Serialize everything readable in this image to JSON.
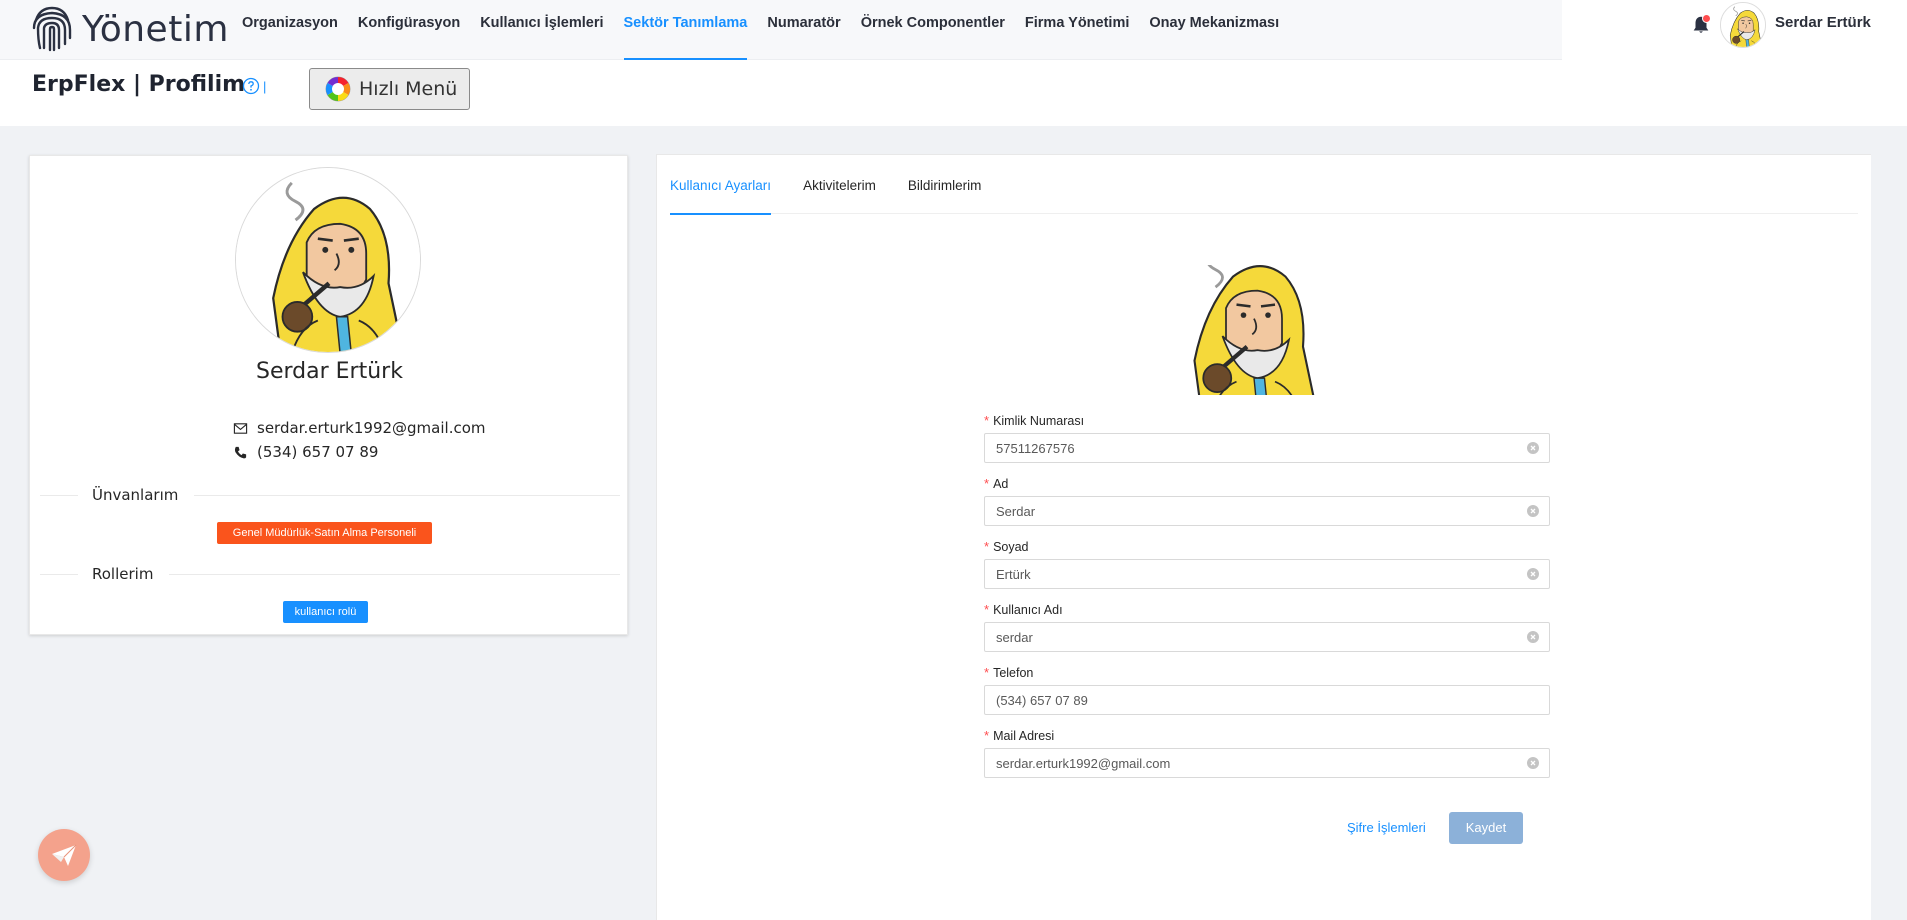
{
  "brand": {
    "name": "Yönetim"
  },
  "nav": {
    "items": [
      {
        "label": "Organizasyon",
        "active": false
      },
      {
        "label": "Konfigürasyon",
        "active": false
      },
      {
        "label": "Kullanıcı İşlemleri",
        "active": false
      },
      {
        "label": "Sektör Tanımlama",
        "active": true
      },
      {
        "label": "Numaratör",
        "active": false
      },
      {
        "label": "Örnek Componentler",
        "active": false
      },
      {
        "label": "Firma Yönetimi",
        "active": false
      },
      {
        "label": "Onay Mekanizması",
        "active": false
      }
    ],
    "username": "Serdar Ertürk",
    "notification_icon": "bell-icon"
  },
  "header": {
    "title": "ErpFlex | Profilim",
    "help_separator": "|",
    "quick_menu_label": "Hızlı Menü"
  },
  "profile": {
    "name": "Serdar Ertürk",
    "email": "serdar.erturk1992@gmail.com",
    "phone": "(534) 657 07 89",
    "titles_heading": "Ünvanlarım",
    "title_tag": "Genel Müdürlük-Satın Alma Personeli",
    "roles_heading": "Rollerim",
    "role_tag": "kullanıcı rolü"
  },
  "tabs": [
    {
      "label": "Kullanıcı Ayarları",
      "active": true
    },
    {
      "label": "Aktivitelerim",
      "active": false
    },
    {
      "label": "Bildirimlerim",
      "active": false
    }
  ],
  "form": {
    "fields": [
      {
        "label": "Kimlik Numarası",
        "value": "57511267576",
        "required": true,
        "clearable": true
      },
      {
        "label": "Ad",
        "value": "Serdar",
        "required": true,
        "clearable": true
      },
      {
        "label": "Soyad",
        "value": "Ertürk",
        "required": true,
        "clearable": true
      },
      {
        "label": "Kullanıcı Adı",
        "value": "serdar",
        "required": true,
        "clearable": true
      },
      {
        "label": "Telefon",
        "value": "(534) 657 07 89",
        "required": true,
        "clearable": false
      },
      {
        "label": "Mail Adresi",
        "value": "serdar.erturk1992@gmail.com",
        "required": true,
        "clearable": true
      }
    ],
    "required_mark": "*",
    "password_link": "Şifre İşlemleri",
    "save_label": "Kaydet"
  },
  "colors": {
    "primary": "#1890ff",
    "tag_orange": "#fa541c",
    "save_disabled": "#8cb1d9",
    "fab": "#f4a28c",
    "avatar_raincoat": "#f5d93a"
  }
}
